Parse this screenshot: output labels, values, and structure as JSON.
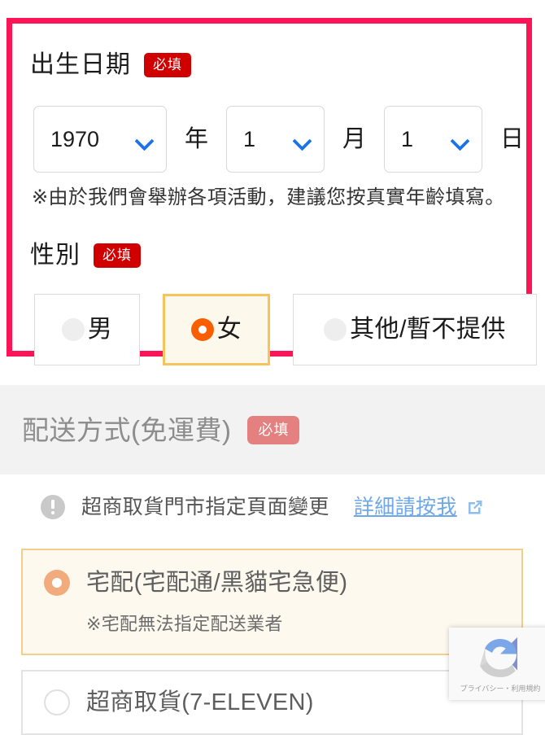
{
  "birthday": {
    "label": "出生日期",
    "required_badge": "必填",
    "year_value": "1970",
    "year_unit": "年",
    "month_value": "1",
    "month_unit": "月",
    "day_value": "1",
    "day_unit": "日",
    "note": "※由於我們會舉辦各項活動，建議您按真實年齡填寫。",
    "chevron_icon": "chevron-down-icon",
    "chevron_color": "#1a73e8"
  },
  "gender": {
    "label": "性別",
    "required_badge": "必填",
    "options": [
      {
        "label": "男",
        "selected": false
      },
      {
        "label": "女",
        "selected": true
      },
      {
        "label": "其他/暫不提供",
        "selected": false
      }
    ],
    "selected_border_color": "#f7c35c",
    "selected_bg_color": "#fdf8ec",
    "selected_radio_color": "#f95f00"
  },
  "shipping": {
    "title": "配送方式(免運費)",
    "required_badge": "必填",
    "band_bg_color": "#f2f2f2",
    "title_color": "#8d8d8d",
    "notice": {
      "icon": "info-exclamation-icon",
      "text": "超商取貨門市指定頁面變更",
      "link_label": "詳細請按我",
      "link_icon": "external-link-icon",
      "link_color": "#6ea8e8"
    },
    "options": [
      {
        "title": "宅配(宅配通/黑貓宅急便)",
        "sub": "※宅配無法指定配送業者",
        "selected": true
      },
      {
        "title": "超商取貨(7-ELEVEN)",
        "sub": "",
        "selected": false
      }
    ]
  },
  "recaptcha": {
    "logo_icon": "recaptcha-logo-icon",
    "text": "プライバシー・利用規約"
  },
  "highlight": {
    "border_color": "#fb1456"
  }
}
